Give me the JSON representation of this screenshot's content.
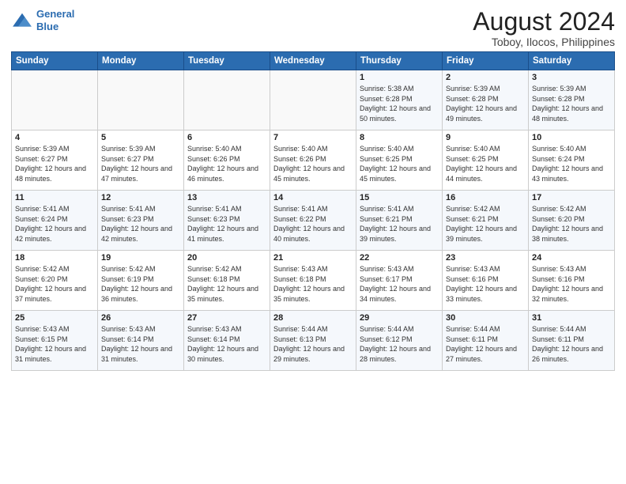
{
  "header": {
    "logo_line1": "General",
    "logo_line2": "Blue",
    "month_year": "August 2024",
    "location": "Toboy, Ilocos, Philippines"
  },
  "weekdays": [
    "Sunday",
    "Monday",
    "Tuesday",
    "Wednesday",
    "Thursday",
    "Friday",
    "Saturday"
  ],
  "weeks": [
    [
      {
        "day": "",
        "content": ""
      },
      {
        "day": "",
        "content": ""
      },
      {
        "day": "",
        "content": ""
      },
      {
        "day": "",
        "content": ""
      },
      {
        "day": "1",
        "content": "Sunrise: 5:38 AM\nSunset: 6:28 PM\nDaylight: 12 hours\nand 50 minutes."
      },
      {
        "day": "2",
        "content": "Sunrise: 5:39 AM\nSunset: 6:28 PM\nDaylight: 12 hours\nand 49 minutes."
      },
      {
        "day": "3",
        "content": "Sunrise: 5:39 AM\nSunset: 6:28 PM\nDaylight: 12 hours\nand 48 minutes."
      }
    ],
    [
      {
        "day": "4",
        "content": "Sunrise: 5:39 AM\nSunset: 6:27 PM\nDaylight: 12 hours\nand 48 minutes."
      },
      {
        "day": "5",
        "content": "Sunrise: 5:39 AM\nSunset: 6:27 PM\nDaylight: 12 hours\nand 47 minutes."
      },
      {
        "day": "6",
        "content": "Sunrise: 5:40 AM\nSunset: 6:26 PM\nDaylight: 12 hours\nand 46 minutes."
      },
      {
        "day": "7",
        "content": "Sunrise: 5:40 AM\nSunset: 6:26 PM\nDaylight: 12 hours\nand 45 minutes."
      },
      {
        "day": "8",
        "content": "Sunrise: 5:40 AM\nSunset: 6:25 PM\nDaylight: 12 hours\nand 45 minutes."
      },
      {
        "day": "9",
        "content": "Sunrise: 5:40 AM\nSunset: 6:25 PM\nDaylight: 12 hours\nand 44 minutes."
      },
      {
        "day": "10",
        "content": "Sunrise: 5:40 AM\nSunset: 6:24 PM\nDaylight: 12 hours\nand 43 minutes."
      }
    ],
    [
      {
        "day": "11",
        "content": "Sunrise: 5:41 AM\nSunset: 6:24 PM\nDaylight: 12 hours\nand 42 minutes."
      },
      {
        "day": "12",
        "content": "Sunrise: 5:41 AM\nSunset: 6:23 PM\nDaylight: 12 hours\nand 42 minutes."
      },
      {
        "day": "13",
        "content": "Sunrise: 5:41 AM\nSunset: 6:23 PM\nDaylight: 12 hours\nand 41 minutes."
      },
      {
        "day": "14",
        "content": "Sunrise: 5:41 AM\nSunset: 6:22 PM\nDaylight: 12 hours\nand 40 minutes."
      },
      {
        "day": "15",
        "content": "Sunrise: 5:41 AM\nSunset: 6:21 PM\nDaylight: 12 hours\nand 39 minutes."
      },
      {
        "day": "16",
        "content": "Sunrise: 5:42 AM\nSunset: 6:21 PM\nDaylight: 12 hours\nand 39 minutes."
      },
      {
        "day": "17",
        "content": "Sunrise: 5:42 AM\nSunset: 6:20 PM\nDaylight: 12 hours\nand 38 minutes."
      }
    ],
    [
      {
        "day": "18",
        "content": "Sunrise: 5:42 AM\nSunset: 6:20 PM\nDaylight: 12 hours\nand 37 minutes."
      },
      {
        "day": "19",
        "content": "Sunrise: 5:42 AM\nSunset: 6:19 PM\nDaylight: 12 hours\nand 36 minutes."
      },
      {
        "day": "20",
        "content": "Sunrise: 5:42 AM\nSunset: 6:18 PM\nDaylight: 12 hours\nand 35 minutes."
      },
      {
        "day": "21",
        "content": "Sunrise: 5:43 AM\nSunset: 6:18 PM\nDaylight: 12 hours\nand 35 minutes."
      },
      {
        "day": "22",
        "content": "Sunrise: 5:43 AM\nSunset: 6:17 PM\nDaylight: 12 hours\nand 34 minutes."
      },
      {
        "day": "23",
        "content": "Sunrise: 5:43 AM\nSunset: 6:16 PM\nDaylight: 12 hours\nand 33 minutes."
      },
      {
        "day": "24",
        "content": "Sunrise: 5:43 AM\nSunset: 6:16 PM\nDaylight: 12 hours\nand 32 minutes."
      }
    ],
    [
      {
        "day": "25",
        "content": "Sunrise: 5:43 AM\nSunset: 6:15 PM\nDaylight: 12 hours\nand 31 minutes."
      },
      {
        "day": "26",
        "content": "Sunrise: 5:43 AM\nSunset: 6:14 PM\nDaylight: 12 hours\nand 31 minutes."
      },
      {
        "day": "27",
        "content": "Sunrise: 5:43 AM\nSunset: 6:14 PM\nDaylight: 12 hours\nand 30 minutes."
      },
      {
        "day": "28",
        "content": "Sunrise: 5:44 AM\nSunset: 6:13 PM\nDaylight: 12 hours\nand 29 minutes."
      },
      {
        "day": "29",
        "content": "Sunrise: 5:44 AM\nSunset: 6:12 PM\nDaylight: 12 hours\nand 28 minutes."
      },
      {
        "day": "30",
        "content": "Sunrise: 5:44 AM\nSunset: 6:11 PM\nDaylight: 12 hours\nand 27 minutes."
      },
      {
        "day": "31",
        "content": "Sunrise: 5:44 AM\nSunset: 6:11 PM\nDaylight: 12 hours\nand 26 minutes."
      }
    ]
  ]
}
